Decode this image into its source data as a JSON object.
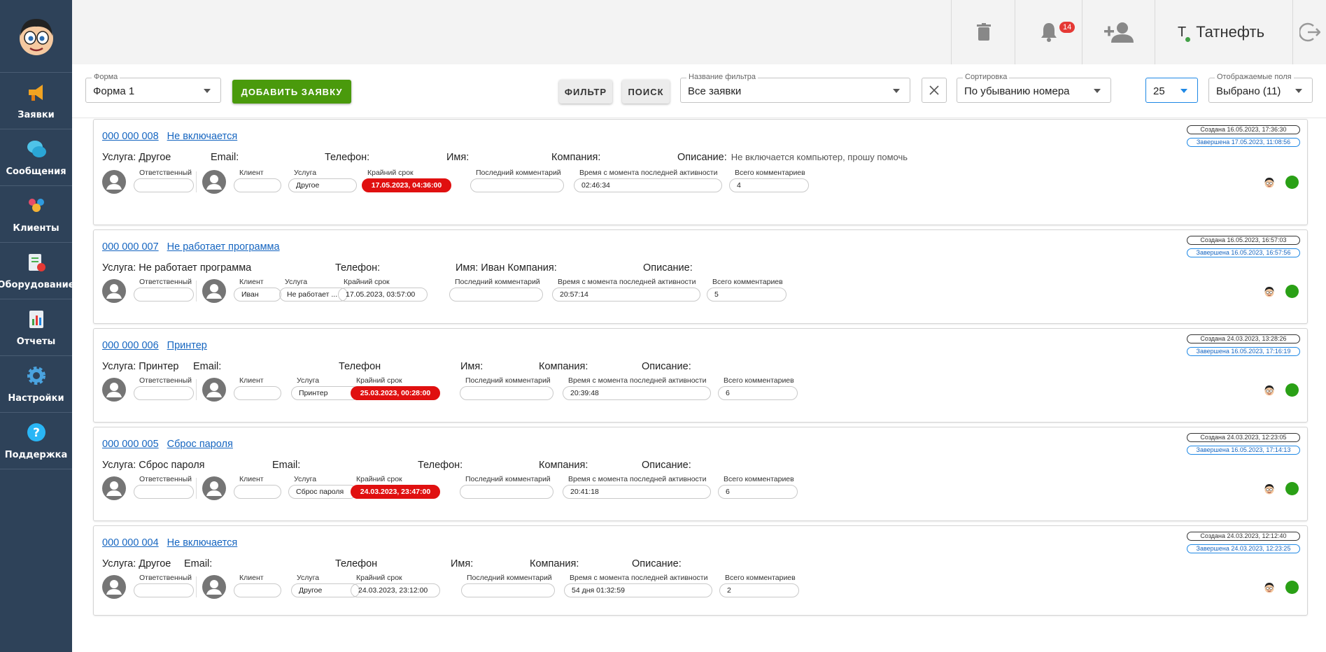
{
  "sidebar": {
    "items": [
      {
        "label": "Заявки",
        "icon": "megaphone-icon"
      },
      {
        "label": "Сообщения",
        "icon": "chat-icon"
      },
      {
        "label": "Клиенты",
        "icon": "clients-icon"
      },
      {
        "label": "Оборудование",
        "icon": "equipment-icon"
      },
      {
        "label": "Отчеты",
        "icon": "reports-icon"
      },
      {
        "label": "Настройки",
        "icon": "gear-icon"
      },
      {
        "label": "Поддержка",
        "icon": "help-icon"
      }
    ]
  },
  "topbar": {
    "notifications_count": "14",
    "user_initial": "Т",
    "user_name": "Татнефть"
  },
  "filters": {
    "form_label": "Форма",
    "form_value": "Форма 1",
    "add_button": "ДОБАВИТЬ ЗАЯВКУ",
    "filter_button": "ФИЛЬТР",
    "search_button": "ПОИСК",
    "filter_name_label": "Название фильтра",
    "filter_name_value": "Все заявки",
    "sort_label": "Сортировка",
    "sort_value": "По убыванию номера",
    "page_size": "25",
    "fields_label": "Отображаемые поля",
    "fields_value": "Выбрано (11)"
  },
  "labels": {
    "responsible": "Ответственный",
    "client": "Клиент",
    "service": "Услуга",
    "deadline": "Крайний срок",
    "last_comment": "Последний комментарий",
    "since_activity": "Время с момента последней активности",
    "total_comments": "Всего комментариев"
  },
  "tickets": [
    {
      "number": "000 000 008",
      "title": "Не включается",
      "service": "Услуга: Другое",
      "email": "Email:",
      "phone": "Телефон:",
      "name": "Имя:",
      "company": "Компания:",
      "description": "Описание:",
      "description_text": "Не включается компьютер, прошу помочь",
      "created": "Создана 16.05.2023, 17:36:30",
      "completed": "Завершена 17.05.2023, 11:08:56",
      "client_value": "",
      "service_value": "Другое",
      "deadline_value": "17.05.2023, 04:36:00",
      "deadline_overdue": true,
      "last_comment": "",
      "since_activity": "02:46:34",
      "total_comments": "4"
    },
    {
      "number": "000 000 007",
      "title": "Не работает программа",
      "service": "Услуга: Не работает программа",
      "email": "",
      "phone": "Телефон:",
      "name": "Имя: Иван Компания:",
      "company": "",
      "description": "Описание:",
      "description_text": "",
      "created": "Создана 16.05.2023, 16:57:03",
      "completed": "Завершена 16.05.2023, 16:57:56",
      "client_value": "Иван",
      "service_value": "Не работает ...",
      "deadline_value": "17.05.2023, 03:57:00",
      "deadline_overdue": false,
      "last_comment": "",
      "since_activity": "20:57:14",
      "total_comments": "5"
    },
    {
      "number": "000 000 006",
      "title": "Принтер",
      "service": "Услуга: Принтер",
      "email": "Email:",
      "phone": "Телефон",
      "name": "Имя:",
      "company": "Компания:",
      "description": "Описание:",
      "description_text": "",
      "created": "Создана 24.03.2023, 13:28:26",
      "completed": "Завершена 16.05.2023, 17:16:19",
      "client_value": "",
      "service_value": "Принтер",
      "deadline_value": "25.03.2023, 00:28:00",
      "deadline_overdue": true,
      "last_comment": "",
      "since_activity": "20:39:48",
      "total_comments": "6"
    },
    {
      "number": "000 000 005",
      "title": "Сброс пароля",
      "service": "Услуга: Сброс пароля",
      "email": "Email:",
      "phone": "Телефон:",
      "name": "",
      "company": "Компания:",
      "description": "Описание:",
      "description_text": "",
      "created": "Создана 24.03.2023, 12:23:05",
      "completed": "Завершена 16.05.2023, 17:14:13",
      "client_value": "",
      "service_value": "Сброс пароля",
      "deadline_value": "24.03.2023, 23:47:00",
      "deadline_overdue": true,
      "last_comment": "",
      "since_activity": "20:41:18",
      "total_comments": "6"
    },
    {
      "number": "000 000 004",
      "title": "Не включается",
      "service": "Услуга: Другое",
      "email": "Email:",
      "phone": "Телефон",
      "name": "Имя:",
      "company": "Компания:",
      "description": "Описание:",
      "description_text": "",
      "created": "Создана 24.03.2023, 12:12:40",
      "completed": "Завершена 24.03.2023, 12:23:25",
      "client_value": "",
      "service_value": "Другое",
      "deadline_value": "24.03.2023, 23:12:00",
      "deadline_overdue": false,
      "last_comment": "",
      "since_activity": "54 дня 01:32:59",
      "total_comments": "2"
    }
  ]
}
